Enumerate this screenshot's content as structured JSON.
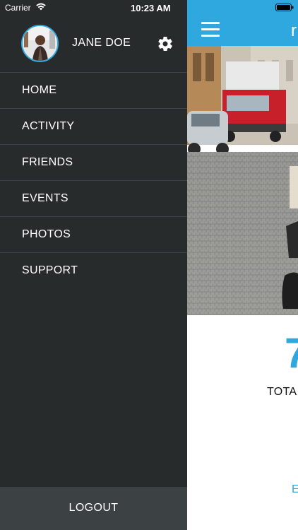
{
  "status_bar": {
    "carrier": "Carrier",
    "time": "10:23 AM",
    "wifi_icon": "wifi-icon",
    "battery_icon": "battery-icon"
  },
  "drawer": {
    "user_name": "JANE DOE",
    "avatar_icon": "avatar-photo",
    "settings_icon": "gear-icon",
    "items": [
      {
        "label": "HOME"
      },
      {
        "label": "ACTIVITY"
      },
      {
        "label": "FRIENDS"
      },
      {
        "label": "EVENTS"
      },
      {
        "label": "PHOTOS"
      },
      {
        "label": "SUPPORT"
      }
    ],
    "logout_label": "LOGOUT"
  },
  "main": {
    "menu_icon": "hamburger-icon",
    "title_peek": "r",
    "hero_image": "street-photo",
    "stat_value_peek": "7",
    "stat_label_peek": "TOTA",
    "link_peek": "E"
  },
  "colors": {
    "accent": "#2fa8df",
    "drawer_bg": "#272b2c",
    "logout_bg": "#3c4244",
    "divider": "#3d4244"
  }
}
